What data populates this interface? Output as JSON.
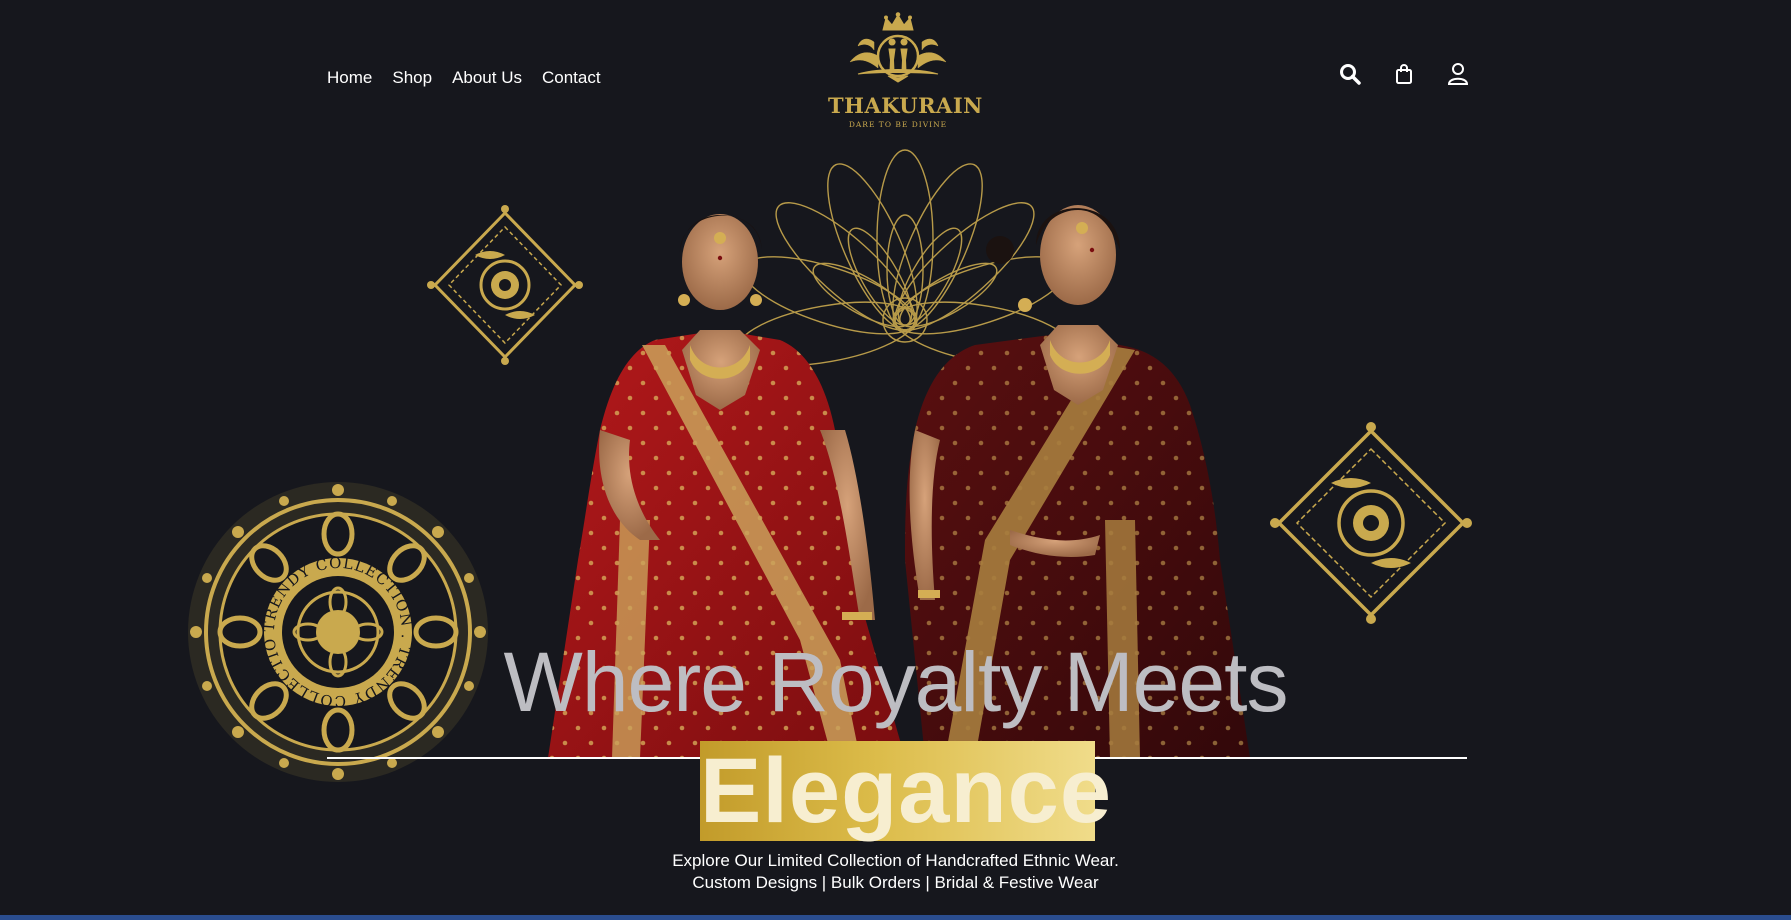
{
  "nav": {
    "items": [
      {
        "label": "Home"
      },
      {
        "label": "Shop"
      },
      {
        "label": "About Us"
      },
      {
        "label": "Contact"
      }
    ]
  },
  "brand": {
    "name": "THAKURAIN",
    "tagline": "DARE TO BE DIVINE",
    "gold": "#c9a94e"
  },
  "header_icons": [
    "search-icon",
    "shopping-bag-icon",
    "user-icon"
  ],
  "hero": {
    "headline": "Where Royalty Meets",
    "highlight": "Elegance",
    "subtitle_line1": "Explore Our Limited Collection of Handcrafted Ethnic Wear.",
    "subtitle_line2": "Custom Designs | Bulk Orders | Bridal & Festive Wear",
    "medallion_text": "TRENDY COLLECTION . TRENDY COLLECTION .",
    "colors": {
      "background": "#16171d",
      "lehenga_red": "#9e1416",
      "saree_maroon": "#4a0c0e",
      "gold": "#c9a94e"
    }
  }
}
